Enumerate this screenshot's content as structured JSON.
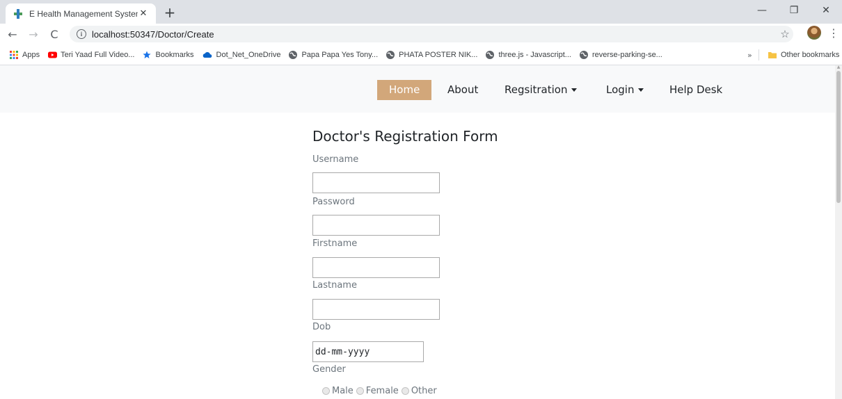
{
  "browser": {
    "tab": {
      "title": "E Health Management System",
      "close_glyph": "✕"
    },
    "new_tab_glyph": "+",
    "window": {
      "minimize": "—",
      "restore": "❐",
      "close": "✕"
    },
    "nav": {
      "back": "←",
      "forward": "→",
      "reload": "C"
    },
    "url": "localhost:50347/Doctor/Create",
    "url_info_glyph": "i",
    "star_glyph": "☆",
    "menu_glyph": "⋮",
    "bookmarks": [
      {
        "label": "Apps",
        "icon": "apps-grid-icon"
      },
      {
        "label": "Teri Yaad Full Video...",
        "icon": "youtube-icon"
      },
      {
        "label": "Bookmarks",
        "icon": "star-icon"
      },
      {
        "label": "Dot_Net_OneDrive",
        "icon": "onedrive-cloud-icon"
      },
      {
        "label": "Papa Papa Yes Tony...",
        "icon": "globe-icon"
      },
      {
        "label": "PHATA POSTER NIK...",
        "icon": "globe-icon"
      },
      {
        "label": "three.js - Javascript...",
        "icon": "globe-icon"
      },
      {
        "label": "reverse-parking-se...",
        "icon": "globe-icon"
      }
    ],
    "bookmarks_overflow": "»",
    "other_bookmarks": "Other bookmarks"
  },
  "site_nav": {
    "home": "Home",
    "about": "About",
    "registration": "Regsitration",
    "login": "Login",
    "help_desk": "Help Desk",
    "active_color": "#d2a77a"
  },
  "form": {
    "title": "Doctor's Registration Form",
    "username_label": "Username",
    "username_value": "",
    "password_label": "Password",
    "password_value": "",
    "firstname_label": "Firstname",
    "firstname_value": "",
    "lastname_label": "Lastname",
    "lastname_value": "",
    "dob_label": "Dob",
    "dob_placeholder": "dd-mm-yyyy",
    "gender_label": "Gender",
    "gender_options": [
      "Male",
      "Female",
      "Other"
    ]
  }
}
